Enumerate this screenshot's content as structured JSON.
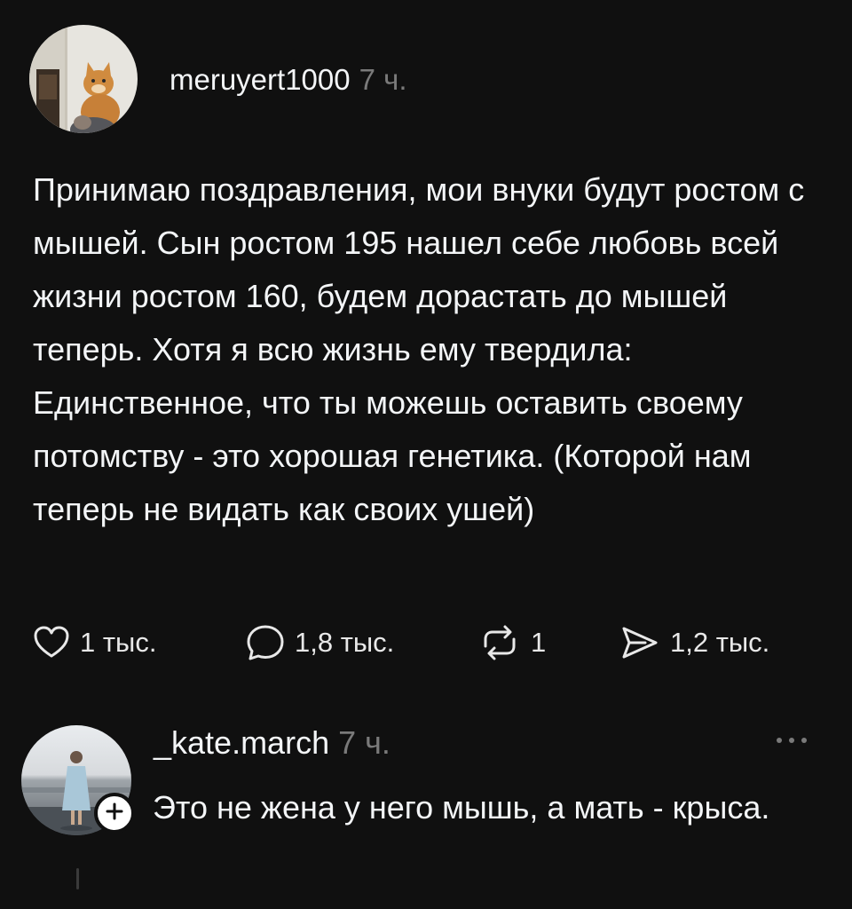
{
  "post": {
    "username": "meruyert1000",
    "timestamp": "7 ч.",
    "text": "Принимаю поздравления, мои внуки будут ростом с мышей. Сын ростом 195 нашел себе любовь всей жизни ростом 160, будем дорастать до мышей теперь. Хотя я всю жизнь ему твердила: Единственное, что ты можешь оставить своему потомству - это хорошая генетика. (Которой нам теперь не видать как своих ушей)",
    "actions": {
      "likes": "1 тыс.",
      "replies": "1,8 тыс.",
      "reposts": "1",
      "shares": "1,2 тыс."
    }
  },
  "reply": {
    "username": "_kate.march",
    "timestamp": "7 ч.",
    "text": "Это не жена у него мышь, а мать - крыса."
  },
  "icons": {
    "like": "heart-icon",
    "reply": "speech-bubble-icon",
    "repost": "repost-icon",
    "share": "send-icon",
    "more": "more-dots-icon",
    "follow": "plus-icon"
  },
  "colors": {
    "background": "#101010",
    "text": "#f3f5f7",
    "muted": "#7a7a7a"
  }
}
